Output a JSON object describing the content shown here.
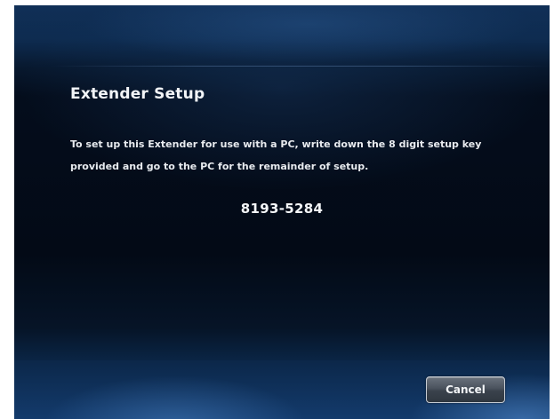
{
  "dialog": {
    "title": "Extender Setup",
    "body": "To set up this Extender for use with a PC, write down the 8 digit setup key provided and go to the PC for the remainder of setup.",
    "setup_key": "8193-5284"
  },
  "buttons": {
    "cancel_label": "Cancel"
  },
  "colors": {
    "background": "#030a16",
    "band_blue": "#0b2b52",
    "text": "#f2f4f7"
  }
}
